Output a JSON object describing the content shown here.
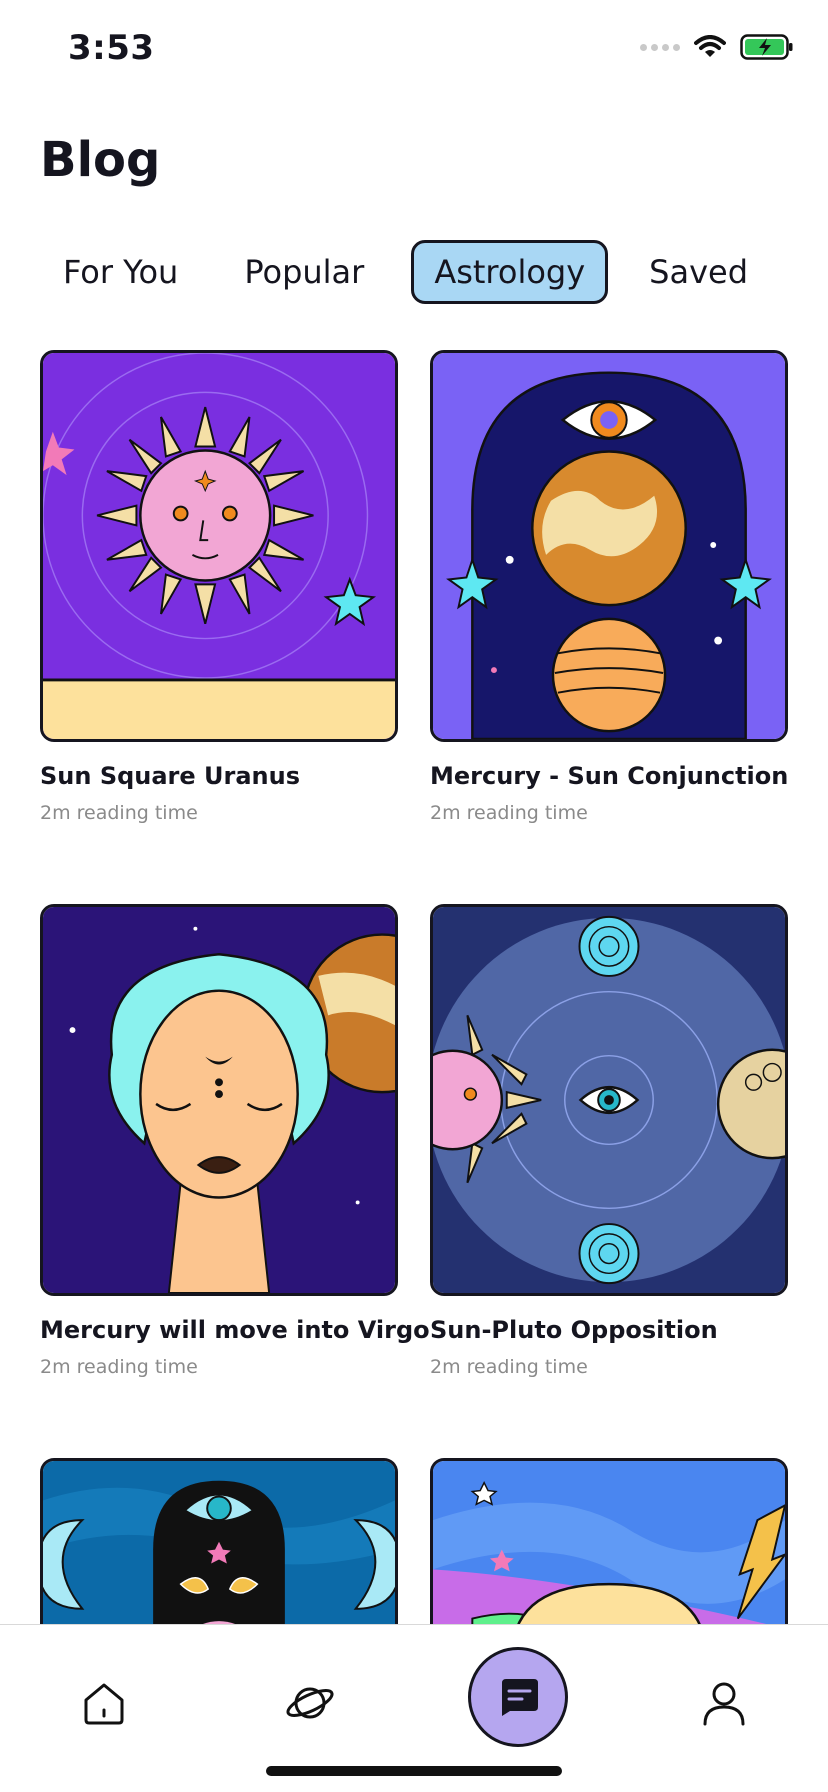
{
  "status": {
    "time": "3:53",
    "icons": [
      "signal-dots-icon",
      "wifi-icon",
      "battery-charging-icon"
    ]
  },
  "header": {
    "title": "Blog"
  },
  "tabs": [
    {
      "label": "For You",
      "active": false
    },
    {
      "label": "Popular",
      "active": false
    },
    {
      "label": "Astrology",
      "active": true
    },
    {
      "label": "Saved",
      "active": false
    }
  ],
  "posts": [
    {
      "title": "Sun Square Uranus",
      "meta": "2m reading time",
      "image": "sun-face-illustration"
    },
    {
      "title": "Mercury - Sun Conjunction",
      "meta": "2m reading time",
      "image": "planets-arch-illustration"
    },
    {
      "title": "Mercury will move into Virgo",
      "meta": "2m reading time",
      "image": "woman-third-eye-illustration"
    },
    {
      "title": "Sun-Pluto Opposition",
      "meta": "2m reading time",
      "image": "sun-eye-moon-orbit-illustration"
    },
    {
      "title": "",
      "meta": "",
      "image": "crescent-moons-eye-illustration"
    },
    {
      "title": "",
      "meta": "",
      "image": "ringed-planet-lightning-illustration"
    }
  ],
  "tab_bar": {
    "items": [
      "home-icon",
      "planet-icon",
      "blog-icon",
      "profile-icon"
    ],
    "active": "blog-icon",
    "accent": "#b5a6ef"
  },
  "colors": {
    "active_tab": "#a9d7f4",
    "text": "#15151f",
    "meta": "#8a8a8a"
  }
}
